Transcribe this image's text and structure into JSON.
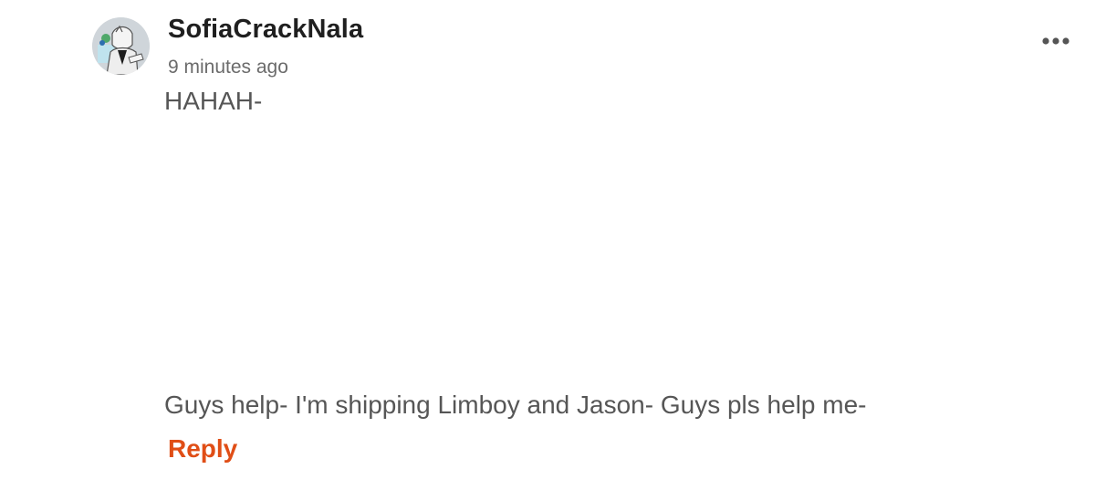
{
  "comment": {
    "username": "SofiaCrackNala",
    "timestamp": "9 minutes ago",
    "body_lines": [
      "HAHAH-",
      "Guys help- I'm shipping Limboy and Jason- Guys pls help me-"
    ],
    "reply_label": "Reply",
    "avatar_icon": "user-avatar-icon",
    "more_icon": "more-horizontal-icon"
  },
  "colors": {
    "reply_accent": "#e04e16",
    "username": "#1f1f1f",
    "timestamp": "#6b6b6b",
    "body_text": "#565656"
  }
}
